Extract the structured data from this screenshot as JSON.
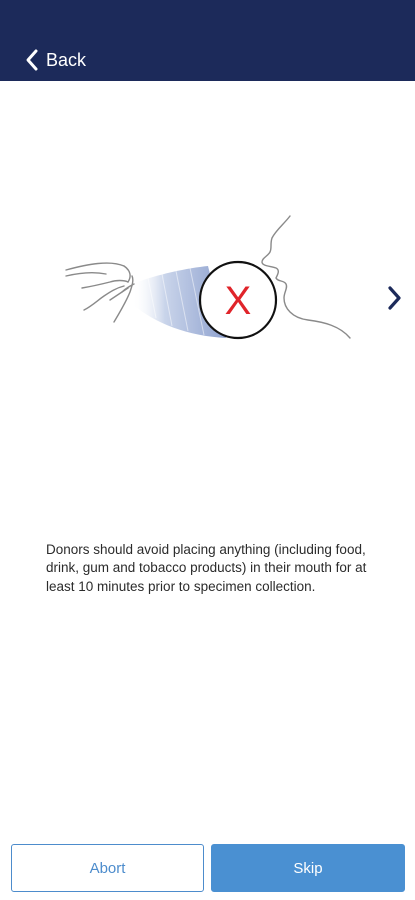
{
  "header": {
    "back_label": "Back",
    "background_color": "#1c2a5a"
  },
  "illustration": {
    "icon": "no-mouth-contact-icon",
    "mark": "X",
    "mark_color": "#e0242a"
  },
  "navigation": {
    "next_icon": "chevron-right-icon"
  },
  "instruction": {
    "text": "Donors should avoid placing anything (including food, drink, gum and tobacco products) in their mouth for at least 10 minutes prior to specimen collection."
  },
  "actions": {
    "abort_label": "Abort",
    "skip_label": "Skip",
    "accent_color": "#4a90d2"
  }
}
